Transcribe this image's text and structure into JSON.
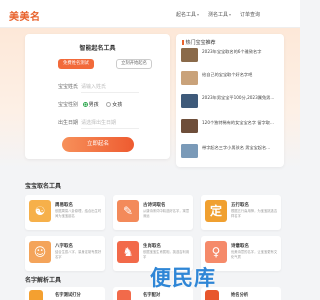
{
  "header": {
    "logo": "美美名",
    "nav": [
      {
        "label": "起名工具",
        "has_caret": true
      },
      {
        "label": "测名工具",
        "has_caret": true
      },
      {
        "label": "订单查询",
        "has_caret": false
      }
    ]
  },
  "form": {
    "title": "智能起名工具",
    "tabs": [
      {
        "label": "免费姓名测试",
        "active": true
      },
      {
        "label": "立刻开始起名",
        "active": false
      }
    ],
    "surname_label": "宝宝姓氏",
    "surname_placeholder": "请输入姓氏",
    "gender_label": "宝宝性别",
    "gender_options": [
      {
        "label": "男孩",
        "selected": true
      },
      {
        "label": "女孩",
        "selected": false
      }
    ],
    "birth_label": "出生日期",
    "birth_placeholder": "请选择出生日期",
    "submit_label": "立即起名"
  },
  "sidebar": {
    "title": "热门宝宝推荐",
    "posts": [
      {
        "text": "2023年宝宝取名的6个雅致名字"
      },
      {
        "text": "给自己的宝宝取个好名字吧"
      },
      {
        "text": "2023年男宝宝平100分,2023属兔男..."
      },
      {
        "text": "120个独特稀有的女宝宝名字 留字取..."
      },
      {
        "text": "带字起名三字小男孩名 男宝宝起名..."
      }
    ],
    "thumb_colors": [
      "#8a6a4a",
      "#c9a27a",
      "#3e5a7a",
      "#6e4e3a",
      "#7a9ab8"
    ]
  },
  "tools_section": {
    "title": "宝宝取名工具",
    "items": [
      {
        "name": "周易取名",
        "desc": "依据周易八卦原理，结合出生时间为宝宝起名",
        "icon": "taiji-icon",
        "color": "#f6b04a"
      },
      {
        "name": "古诗词取名",
        "desc": "从唐诗宋词中精选好名字，寓意深远",
        "icon": "scroll-icon",
        "color": "#f38a5a"
      },
      {
        "name": "五行取名",
        "desc": "根据五行喜用神，为宝宝挑选吉祥名字",
        "icon": "ding-icon",
        "color": "#f0a030"
      },
      {
        "name": "八字取名",
        "desc": "结合生辰八字，量身定制专属好名字",
        "icon": "child-icon",
        "color": "#f4a45a"
      },
      {
        "name": "生肖取名",
        "desc": "依据宝宝生肖属相，挑选吉利用字",
        "icon": "zodiac-icon",
        "color": "#f26a4a"
      },
      {
        "name": "诗意取名",
        "desc": "优美诗意的名字，让宝宝更有文化气质",
        "icon": "lady-icon",
        "color": "#f58a6a"
      }
    ]
  },
  "analyze_section": {
    "title": "名字解析工具",
    "items": [
      {
        "name": "名字测试打分",
        "icon": "score-icon",
        "color": "#f4a030"
      },
      {
        "name": "名字配对",
        "icon": "pair-icon",
        "color": "#f26a4a"
      },
      {
        "name": "姓名分析",
        "icon": "analyze-icon",
        "color": "#e8562c"
      }
    ]
  },
  "watermark": "便民库",
  "colors": {
    "accent": "#e8622c",
    "button": "#f26a3a",
    "watermark": "#2f86d6"
  }
}
